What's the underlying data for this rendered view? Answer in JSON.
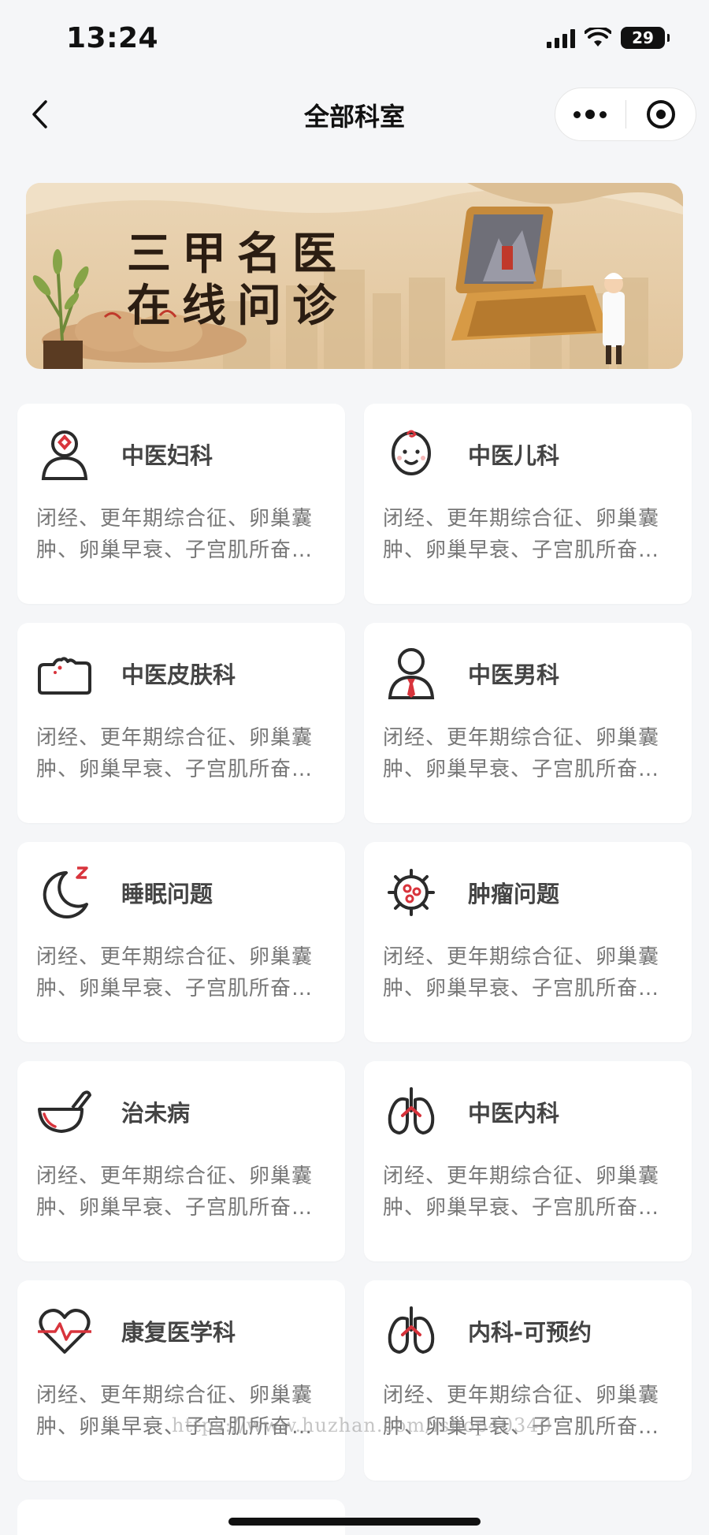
{
  "status_bar": {
    "time": "13:24",
    "battery": "29"
  },
  "nav": {
    "title": "全部科室"
  },
  "banner": {
    "line1": "三甲名医",
    "line2": "在线问诊"
  },
  "departments": [
    {
      "name": "中医妇科",
      "icon": "female-doctor-icon",
      "desc": "闭经、更年期综合征、卵巢囊肿、卵巢早衰、子宫肌所奋…"
    },
    {
      "name": "中医儿科",
      "icon": "baby-face-icon",
      "desc": "闭经、更年期综合征、卵巢囊肿、卵巢早衰、子宫肌所奋…"
    },
    {
      "name": "中医皮肤科",
      "icon": "skin-icon",
      "desc": "闭经、更年期综合征、卵巢囊肿、卵巢早衰、子宫肌所奋…"
    },
    {
      "name": "中医男科",
      "icon": "male-doctor-icon",
      "desc": "闭经、更年期综合征、卵巢囊肿、卵巢早衰、子宫肌所奋…"
    },
    {
      "name": "睡眠问题",
      "icon": "moon-sleep-icon",
      "desc": "闭经、更年期综合征、卵巢囊肿、卵巢早衰、子宫肌所奋…"
    },
    {
      "name": "肿瘤问题",
      "icon": "tumor-cell-icon",
      "desc": "闭经、更年期综合征、卵巢囊肿、卵巢早衰、子宫肌所奋…"
    },
    {
      "name": "治未病",
      "icon": "mortar-icon",
      "desc": "闭经、更年期综合征、卵巢囊肿、卵巢早衰、子宫肌所奋…"
    },
    {
      "name": "中医内科",
      "icon": "lungs-icon",
      "desc": "闭经、更年期综合征、卵巢囊肿、卵巢早衰、子宫肌所奋…"
    },
    {
      "name": "康复医学科",
      "icon": "heart-pulse-icon",
      "desc": "闭经、更年期综合征、卵巢囊肿、卵巢早衰、子宫肌所奋…"
    },
    {
      "name": "内科-可预约",
      "icon": "lungs-icon",
      "desc": "闭经、更年期综合征、卵巢囊肿、卵巢早衰、子宫肌所奋…"
    }
  ],
  "watermark": "https://www.huzhan.com/ishop40340",
  "colors": {
    "accent_red": "#d8343c",
    "icon_dark": "#2b2b2b"
  }
}
